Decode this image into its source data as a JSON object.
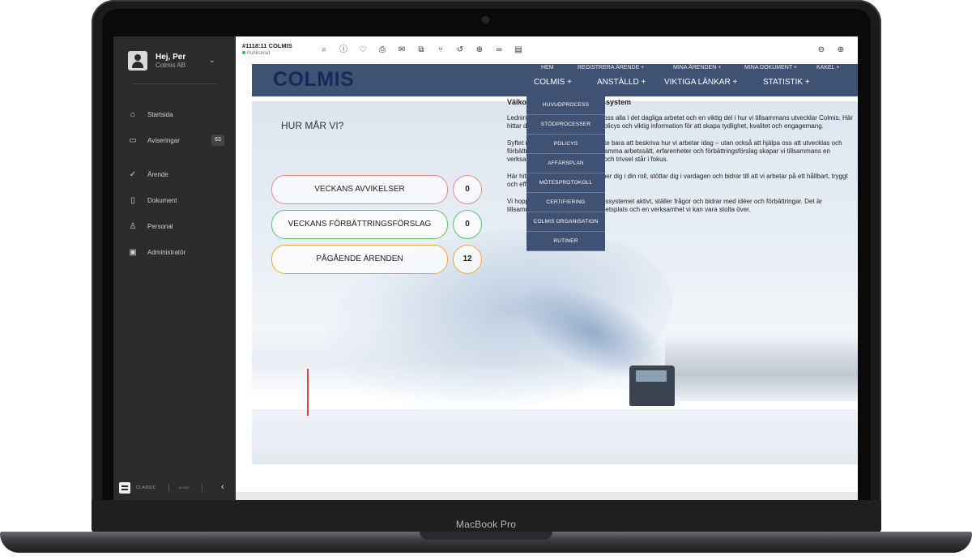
{
  "device": {
    "label": "MacBook Pro"
  },
  "sidebar": {
    "user": {
      "greeting": "Hej, Per",
      "org": "Colmis AB"
    },
    "items": [
      {
        "label": "Startsida",
        "icon": "home-icon"
      },
      {
        "label": "Aviseringar",
        "icon": "inbox-icon",
        "badge": "63"
      },
      {
        "label": "Ärende",
        "icon": "check-icon"
      },
      {
        "label": "Dokument",
        "icon": "document-icon"
      },
      {
        "label": "Personal",
        "icon": "person-icon"
      },
      {
        "label": "Administratör",
        "icon": "briefcase-icon"
      }
    ],
    "footer": {
      "mode": "CLASSIC",
      "version": "6.3.007"
    }
  },
  "topbar": {
    "title": "#1118:11 COLMIS",
    "status": "Publicerad",
    "icons": [
      "search-icon",
      "info-icon",
      "heart-icon",
      "print-icon",
      "mail-icon",
      "copy-icon",
      "branch-icon",
      "history-icon",
      "upload-icon",
      "link-icon",
      "archive-icon",
      "zoom-out-icon",
      "zoom-in-icon"
    ]
  },
  "site": {
    "logo": "COLMIS",
    "nav_top": [
      "HEM",
      "REGISTRERA ÄRENDE +",
      "MINA ÄRENDEN +",
      "MINA DOKUMENT +",
      "KAKEL +"
    ],
    "nav_main": [
      "COLMIS +",
      "ANSTÄLLD +",
      "VIKTIGA LÄNKAR +",
      "STATISTIK +"
    ],
    "dropdown": [
      "HUVUDPROCESS",
      "STÖDPROCESSER",
      "POLICYS",
      "AFFÄRSPLAN",
      "MÖTESPROTOKOLL",
      "CERTIFIERING",
      "COLMIS ORGANISATION",
      "RUTINER"
    ]
  },
  "survey": {
    "title": "HUR MÅR VI?",
    "rows": [
      {
        "label": "VECKANS AVVIKELSER",
        "count": "0",
        "color": "#e88a8a"
      },
      {
        "label": "VECKANS FÖRBÄTTRINGSFÖRSLAG",
        "count": "0",
        "color": "#5cc26a"
      },
      {
        "label": "PÅGÅENDE ÄRENDEN",
        "count": "12",
        "color": "#f0a83a"
      }
    ]
  },
  "article": {
    "heading": "Välkommen till vårt ledningssystem",
    "p1": "Ledningssystemet är grunden för oss alla i det dagliga arbetet och en viktig del i hur vi tillsammans utvecklar Colmis. Här hittar du våra arbetssätt, rutiner, policys och viktig information för att skapa tydlighet, kvalitet och engagemang.",
    "p2": "Syftet med ledningssystemet är inte bara att beskriva hur vi arbetar idag – utan också att hjälpa oss att utvecklas och förbättras framåt. Genom gemensamma arbetssätt, erfarenheter och förbättringsförslag skapar vi tillsammans en verksamhet där kvalitet, säkerhet och trivsel står i fokus.",
    "p3": "Här hittar du information som hjälper dig i din roll, stöttar dig i vardagen och bidrar till att vi arbetar på ett hållbart, tryggt och effektivt sätt.",
    "p4": "Vi hoppas att du använder ledningssystemet aktivt, ställer frågor och bidrar med idéer och förbättringar. Det är tillsammans vi bygger en stark arbetsplats och en verksamhet vi kan vara stolta över."
  }
}
